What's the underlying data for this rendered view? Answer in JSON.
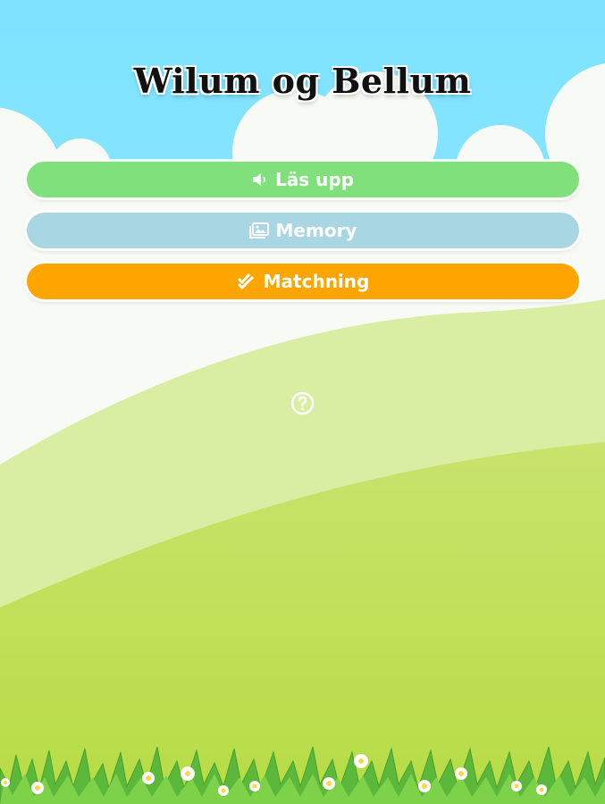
{
  "app": {
    "title": "Wilum og Bellum"
  },
  "menu": {
    "items": [
      {
        "label": "Läs upp",
        "icon": "speaker-icon"
      },
      {
        "label": "Memory",
        "icon": "image-icon"
      },
      {
        "label": "Matchning",
        "icon": "double-check-icon"
      }
    ]
  },
  "help": {
    "icon": "question-circle-icon"
  },
  "colors": {
    "sky": "#7fe4ff",
    "button_read": "#80e07c",
    "button_memory": "#a9d6e3",
    "button_match": "#ffa500"
  }
}
